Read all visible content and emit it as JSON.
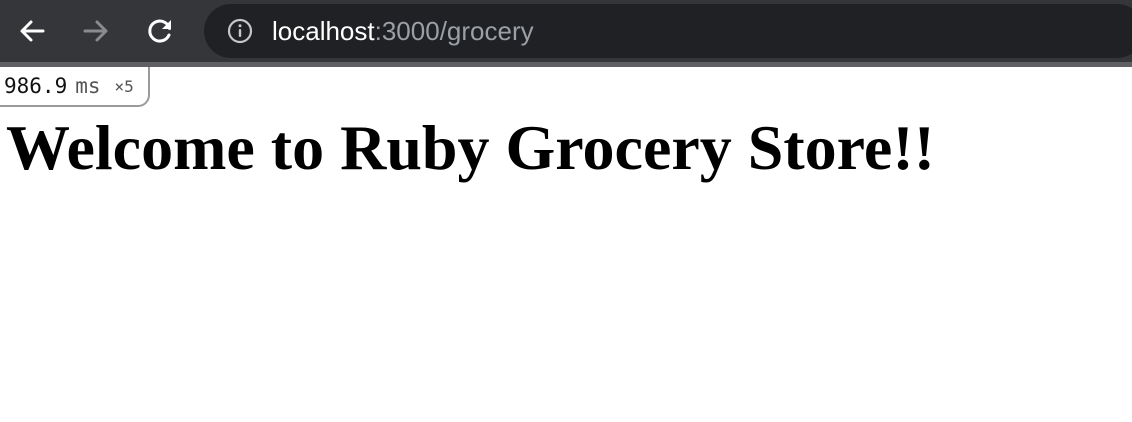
{
  "browser": {
    "url_host": "localhost",
    "url_path": ":3000/grocery",
    "icons": {
      "back": "back-arrow-icon",
      "forward": "forward-arrow-icon",
      "reload": "reload-icon",
      "site_info": "info-icon"
    }
  },
  "perf_badge": {
    "time": "986.9",
    "unit": "ms",
    "count": "×5"
  },
  "page": {
    "heading": "Welcome to Ruby Grocery Store!!"
  },
  "colors": {
    "toolbar_bg": "#35363a",
    "omnibox_bg": "#202124",
    "url_host": "#ffffff",
    "url_path": "#9aa0a6",
    "forward_disabled": "#8a8b8f"
  }
}
